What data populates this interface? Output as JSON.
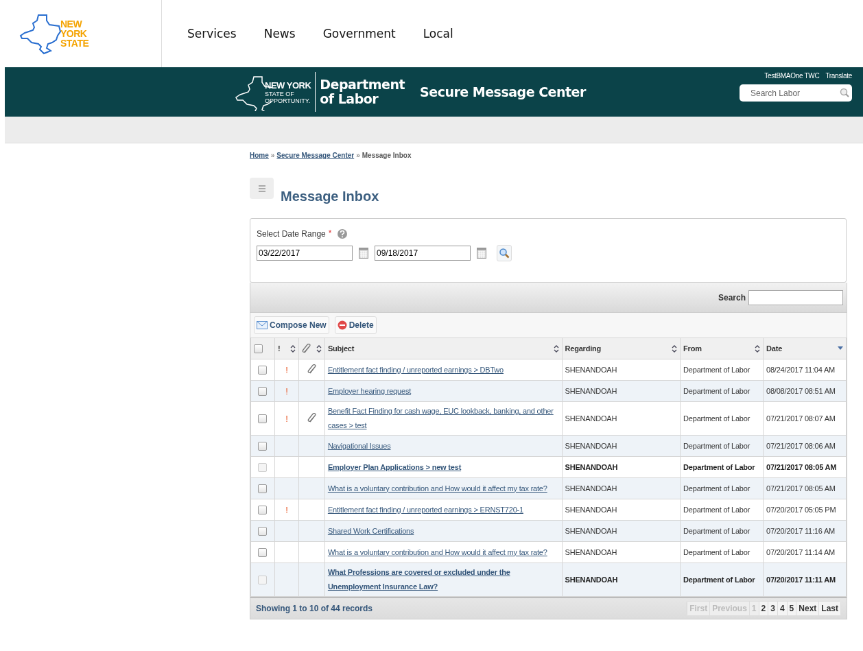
{
  "top_nav": {
    "logo": [
      "NEW",
      "YORK",
      "STATE"
    ],
    "links": [
      "Services",
      "News",
      "Government",
      "Local"
    ]
  },
  "banner": {
    "logo_lines": [
      "NEW YORK",
      "STATE OF",
      "OPPORTUNITY."
    ],
    "department": [
      "Department",
      "of Labor"
    ],
    "title": "Secure Message Center",
    "user": "TestBMAOne TWC",
    "translate": "Translate",
    "search": {
      "placeholder": "Search Labor"
    }
  },
  "breadcrumb": [
    {
      "label": "Home",
      "link": true
    },
    {
      "separator": "»",
      "label": "Secure Message Center",
      "link": true
    },
    {
      "separator": "»",
      "label": "Message Inbox",
      "link": false
    }
  ],
  "page_title": "Message Inbox",
  "date_range": {
    "label": "Select Date Range",
    "required": "*",
    "from": "03/22/2017",
    "to": "09/18/2017"
  },
  "table_search": {
    "label": "Search"
  },
  "actions": [
    {
      "kind": "compose",
      "label": "Compose New"
    },
    {
      "kind": "delete",
      "label": "Delete"
    }
  ],
  "table": {
    "columns": [
      {
        "kind": "check",
        "checked": false
      },
      {
        "kind": "priority",
        "label": "!",
        "sortable": true
      },
      {
        "kind": "attachment",
        "sortable": true
      },
      {
        "kind": "text",
        "label": "Subject",
        "sortable": true
      },
      {
        "kind": "text",
        "label": "Regarding",
        "sortable": true
      },
      {
        "kind": "text",
        "label": "From",
        "sortable": true
      },
      {
        "kind": "text",
        "label": "Date",
        "sorted_descending": true
      }
    ],
    "rows": [
      {
        "flag": "!",
        "attachment": true,
        "subject": "Entitlement fact finding / unreported earnings > DBTwo",
        "regarding": "SHENANDOAH",
        "from": "Department of Labor",
        "date": "08/24/2017 11:04 AM",
        "unread": false
      },
      {
        "flag": "!",
        "attachment": false,
        "subject": "Employer hearing request",
        "regarding": "SHENANDOAH",
        "from": "Department of Labor",
        "date": "08/08/2017 08:51 AM",
        "unread": false
      },
      {
        "flag": "!",
        "attachment": true,
        "subject": "Benefit Fact Finding for cash wage, EUC lookback, banking, and other cases > test",
        "regarding": "SHENANDOAH",
        "from": "Department of Labor",
        "date": "07/21/2017 08:07 AM",
        "unread": false
      },
      {
        "attachment": false,
        "subject": "Navigational Issues",
        "regarding": "SHENANDOAH",
        "from": "Department of Labor",
        "date": "07/21/2017 08:06 AM",
        "unread": false
      },
      {
        "attachment": false,
        "subject": "Employer Plan Applications > new test",
        "regarding": "SHENANDOAH",
        "from": "Department of Labor",
        "date": "07/21/2017 08:05 AM",
        "unread": true
      },
      {
        "attachment": false,
        "subject": "What is a voluntary contribution and How would it affect my tax rate?",
        "regarding": "SHENANDOAH",
        "from": "Department of Labor",
        "date": "07/21/2017 08:05 AM",
        "unread": false
      },
      {
        "flag": "!",
        "attachment": false,
        "subject": "Entitlement fact finding / unreported earnings > ERNST720-1",
        "regarding": "SHENANDOAH",
        "from": "Department of Labor",
        "date": "07/20/2017 05:05 PM",
        "unread": false
      },
      {
        "attachment": false,
        "subject": "Shared Work Certifications",
        "regarding": "SHENANDOAH",
        "from": "Department of Labor",
        "date": "07/20/2017 11:16 AM",
        "unread": false
      },
      {
        "attachment": false,
        "subject": "What is a voluntary contribution and How would it affect my tax rate?",
        "regarding": "SHENANDOAH",
        "from": "Department of Labor",
        "date": "07/20/2017 11:14 AM",
        "unread": false
      },
      {
        "attachment": false,
        "subject": "What Professions are covered or excluded under the Unemployment Insurance Law?",
        "regarding": "SHENANDOAH",
        "from": "Department of Labor",
        "date": "07/20/2017 11:11 AM",
        "unread": true
      }
    ]
  },
  "footer": {
    "summary": "Showing 1 to 10 of 44 records",
    "pager": [
      {
        "label": "First",
        "disabled": true
      },
      {
        "label": "Previous",
        "disabled": true
      },
      {
        "label": "1",
        "disabled": true
      },
      {
        "label": "2",
        "disabled": false
      },
      {
        "label": "3",
        "disabled": false
      },
      {
        "label": "4",
        "disabled": false
      },
      {
        "label": "5",
        "disabled": false
      },
      {
        "label": "Next",
        "disabled": false
      },
      {
        "label": "Last",
        "disabled": false
      }
    ]
  }
}
